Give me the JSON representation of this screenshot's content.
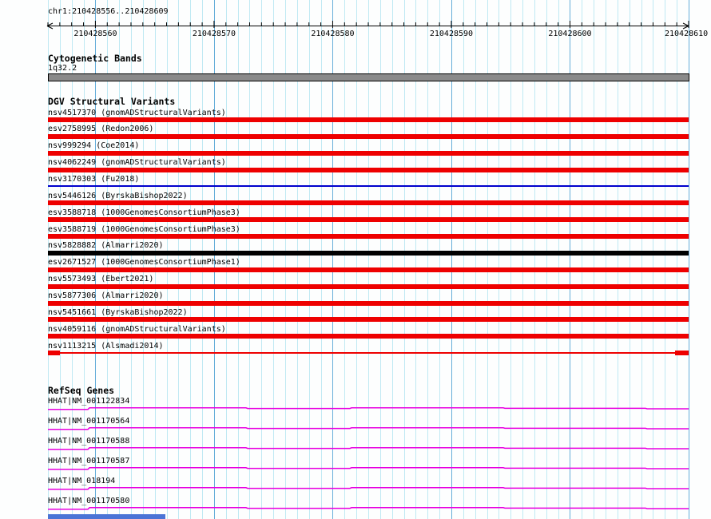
{
  "header": {
    "title": "chr1:210428556..210428609"
  },
  "ruler": {
    "tick_labels": [
      "210428560",
      "210428570",
      "210428580",
      "210428590",
      "210428600",
      "210428610"
    ]
  },
  "cytobands": {
    "header": "Cytogenetic Bands",
    "band_label": "1q32.2"
  },
  "dgv": {
    "header": "DGV Structural Variants",
    "variants": [
      {
        "label": "nsv4517370 (gnomADStructuralVariants)",
        "style": "bar-red"
      },
      {
        "label": "esv2758995 (Redon2006)",
        "style": "bar-red"
      },
      {
        "label": "nsv999294 (Coe2014)",
        "style": "bar-red"
      },
      {
        "label": "nsv4062249 (gnomADStructuralVariants)",
        "style": "bar-red"
      },
      {
        "label": "nsv3170303 (Fu2018)",
        "style": "line-blue"
      },
      {
        "label": "nsv5446126 (ByrskaBishop2022)",
        "style": "bar-red"
      },
      {
        "label": "esv3588718 (1000GenomesConsortiumPhase3)",
        "style": "bar-red"
      },
      {
        "label": "esv3588719 (1000GenomesConsortiumPhase3)",
        "style": "bar-red"
      },
      {
        "label": "nsv5828882 (Almarri2020)",
        "style": "bar-black"
      },
      {
        "label": "esv2671527 (1000GenomesConsortiumPhase1)",
        "style": "bar-red"
      },
      {
        "label": "nsv5573493 (Ebert2021)",
        "style": "bar-red"
      },
      {
        "label": "nsv5877306 (Almarri2020)",
        "style": "bar-red"
      },
      {
        "label": "nsv5451661 (ByrskaBishop2022)",
        "style": "bar-red"
      },
      {
        "label": "nsv4059116 (gnomADStructuralVariants)",
        "style": "bar-red"
      },
      {
        "label": "nsv1113215 (Alsmadi2014)",
        "style": "line-red-ends"
      }
    ]
  },
  "refseq": {
    "header": "RefSeq Genes",
    "genes": [
      {
        "label": "HHAT|NM_001122834"
      },
      {
        "label": "HHAT|NM_001170564"
      },
      {
        "label": "HHAT|NM_001170588"
      },
      {
        "label": "HHAT|NM_001170587"
      },
      {
        "label": "HHAT|NM_018194"
      },
      {
        "label": "HHAT|NM_001170580"
      }
    ]
  },
  "colors": {
    "variant_red": "#ee0000",
    "variant_black": "#000000",
    "variant_blue": "#0000cc",
    "gene_magenta": "#e800e0",
    "band_fill": "#8a8a8a",
    "band_border": "#000000",
    "grid_minor": "#bfe9f3",
    "grid_major": "#66aed9",
    "axis": "#000000",
    "scroll_thumb_blue": "#4b74d6"
  }
}
